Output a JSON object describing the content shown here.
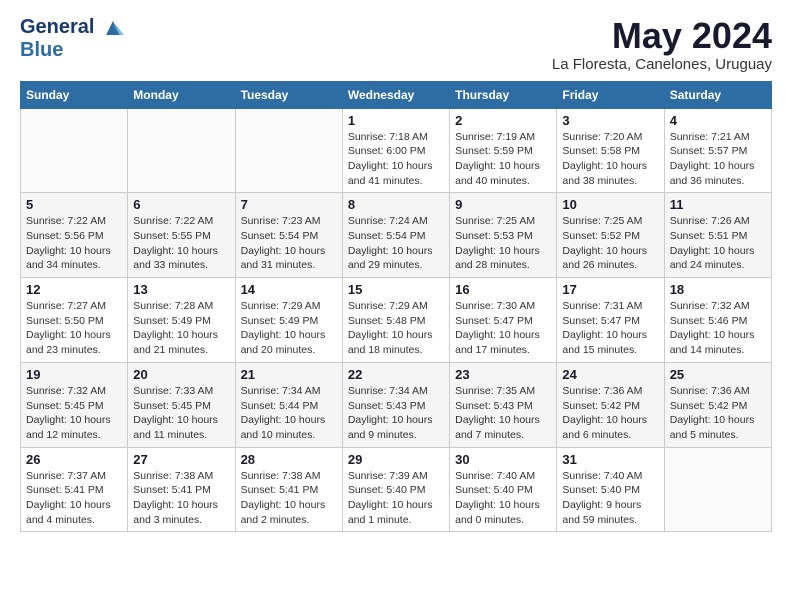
{
  "header": {
    "logo_line1": "General",
    "logo_line2": "Blue",
    "month": "May 2024",
    "location": "La Floresta, Canelones, Uruguay"
  },
  "weekdays": [
    "Sunday",
    "Monday",
    "Tuesday",
    "Wednesday",
    "Thursday",
    "Friday",
    "Saturday"
  ],
  "weeks": [
    [
      {
        "day": "",
        "info": ""
      },
      {
        "day": "",
        "info": ""
      },
      {
        "day": "",
        "info": ""
      },
      {
        "day": "1",
        "info": "Sunrise: 7:18 AM\nSunset: 6:00 PM\nDaylight: 10 hours\nand 41 minutes."
      },
      {
        "day": "2",
        "info": "Sunrise: 7:19 AM\nSunset: 5:59 PM\nDaylight: 10 hours\nand 40 minutes."
      },
      {
        "day": "3",
        "info": "Sunrise: 7:20 AM\nSunset: 5:58 PM\nDaylight: 10 hours\nand 38 minutes."
      },
      {
        "day": "4",
        "info": "Sunrise: 7:21 AM\nSunset: 5:57 PM\nDaylight: 10 hours\nand 36 minutes."
      }
    ],
    [
      {
        "day": "5",
        "info": "Sunrise: 7:22 AM\nSunset: 5:56 PM\nDaylight: 10 hours\nand 34 minutes."
      },
      {
        "day": "6",
        "info": "Sunrise: 7:22 AM\nSunset: 5:55 PM\nDaylight: 10 hours\nand 33 minutes."
      },
      {
        "day": "7",
        "info": "Sunrise: 7:23 AM\nSunset: 5:54 PM\nDaylight: 10 hours\nand 31 minutes."
      },
      {
        "day": "8",
        "info": "Sunrise: 7:24 AM\nSunset: 5:54 PM\nDaylight: 10 hours\nand 29 minutes."
      },
      {
        "day": "9",
        "info": "Sunrise: 7:25 AM\nSunset: 5:53 PM\nDaylight: 10 hours\nand 28 minutes."
      },
      {
        "day": "10",
        "info": "Sunrise: 7:25 AM\nSunset: 5:52 PM\nDaylight: 10 hours\nand 26 minutes."
      },
      {
        "day": "11",
        "info": "Sunrise: 7:26 AM\nSunset: 5:51 PM\nDaylight: 10 hours\nand 24 minutes."
      }
    ],
    [
      {
        "day": "12",
        "info": "Sunrise: 7:27 AM\nSunset: 5:50 PM\nDaylight: 10 hours\nand 23 minutes."
      },
      {
        "day": "13",
        "info": "Sunrise: 7:28 AM\nSunset: 5:49 PM\nDaylight: 10 hours\nand 21 minutes."
      },
      {
        "day": "14",
        "info": "Sunrise: 7:29 AM\nSunset: 5:49 PM\nDaylight: 10 hours\nand 20 minutes."
      },
      {
        "day": "15",
        "info": "Sunrise: 7:29 AM\nSunset: 5:48 PM\nDaylight: 10 hours\nand 18 minutes."
      },
      {
        "day": "16",
        "info": "Sunrise: 7:30 AM\nSunset: 5:47 PM\nDaylight: 10 hours\nand 17 minutes."
      },
      {
        "day": "17",
        "info": "Sunrise: 7:31 AM\nSunset: 5:47 PM\nDaylight: 10 hours\nand 15 minutes."
      },
      {
        "day": "18",
        "info": "Sunrise: 7:32 AM\nSunset: 5:46 PM\nDaylight: 10 hours\nand 14 minutes."
      }
    ],
    [
      {
        "day": "19",
        "info": "Sunrise: 7:32 AM\nSunset: 5:45 PM\nDaylight: 10 hours\nand 12 minutes."
      },
      {
        "day": "20",
        "info": "Sunrise: 7:33 AM\nSunset: 5:45 PM\nDaylight: 10 hours\nand 11 minutes."
      },
      {
        "day": "21",
        "info": "Sunrise: 7:34 AM\nSunset: 5:44 PM\nDaylight: 10 hours\nand 10 minutes."
      },
      {
        "day": "22",
        "info": "Sunrise: 7:34 AM\nSunset: 5:43 PM\nDaylight: 10 hours\nand 9 minutes."
      },
      {
        "day": "23",
        "info": "Sunrise: 7:35 AM\nSunset: 5:43 PM\nDaylight: 10 hours\nand 7 minutes."
      },
      {
        "day": "24",
        "info": "Sunrise: 7:36 AM\nSunset: 5:42 PM\nDaylight: 10 hours\nand 6 minutes."
      },
      {
        "day": "25",
        "info": "Sunrise: 7:36 AM\nSunset: 5:42 PM\nDaylight: 10 hours\nand 5 minutes."
      }
    ],
    [
      {
        "day": "26",
        "info": "Sunrise: 7:37 AM\nSunset: 5:41 PM\nDaylight: 10 hours\nand 4 minutes."
      },
      {
        "day": "27",
        "info": "Sunrise: 7:38 AM\nSunset: 5:41 PM\nDaylight: 10 hours\nand 3 minutes."
      },
      {
        "day": "28",
        "info": "Sunrise: 7:38 AM\nSunset: 5:41 PM\nDaylight: 10 hours\nand 2 minutes."
      },
      {
        "day": "29",
        "info": "Sunrise: 7:39 AM\nSunset: 5:40 PM\nDaylight: 10 hours\nand 1 minute."
      },
      {
        "day": "30",
        "info": "Sunrise: 7:40 AM\nSunset: 5:40 PM\nDaylight: 10 hours\nand 0 minutes."
      },
      {
        "day": "31",
        "info": "Sunrise: 7:40 AM\nSunset: 5:40 PM\nDaylight: 9 hours\nand 59 minutes."
      },
      {
        "day": "",
        "info": ""
      }
    ]
  ]
}
